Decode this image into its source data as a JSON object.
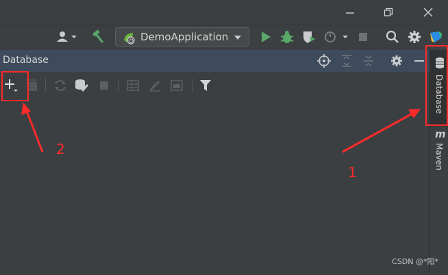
{
  "window": {
    "minimize_label": "—",
    "restore_label": "❐",
    "close_label": "✕"
  },
  "toolbar": {
    "run_configuration": "DemoApplication"
  },
  "panel": {
    "title": "Database"
  },
  "right_sidebar": {
    "tabs": [
      {
        "label": "Database",
        "icon": "database-icon",
        "selected": true
      },
      {
        "label": "Maven",
        "icon": "maven-icon",
        "selected": false
      }
    ],
    "maven_icon_glyph": "m"
  },
  "annotations": {
    "label_1": "1",
    "label_2": "2",
    "color": "#ff2a2a"
  },
  "watermark": "CSDN @*阳*",
  "colors": {
    "background": "#3c3f41",
    "panel_header": "#3d4b5c",
    "run_green": "#59a869",
    "build_green": "#59a869",
    "debug_green": "#59a869"
  }
}
